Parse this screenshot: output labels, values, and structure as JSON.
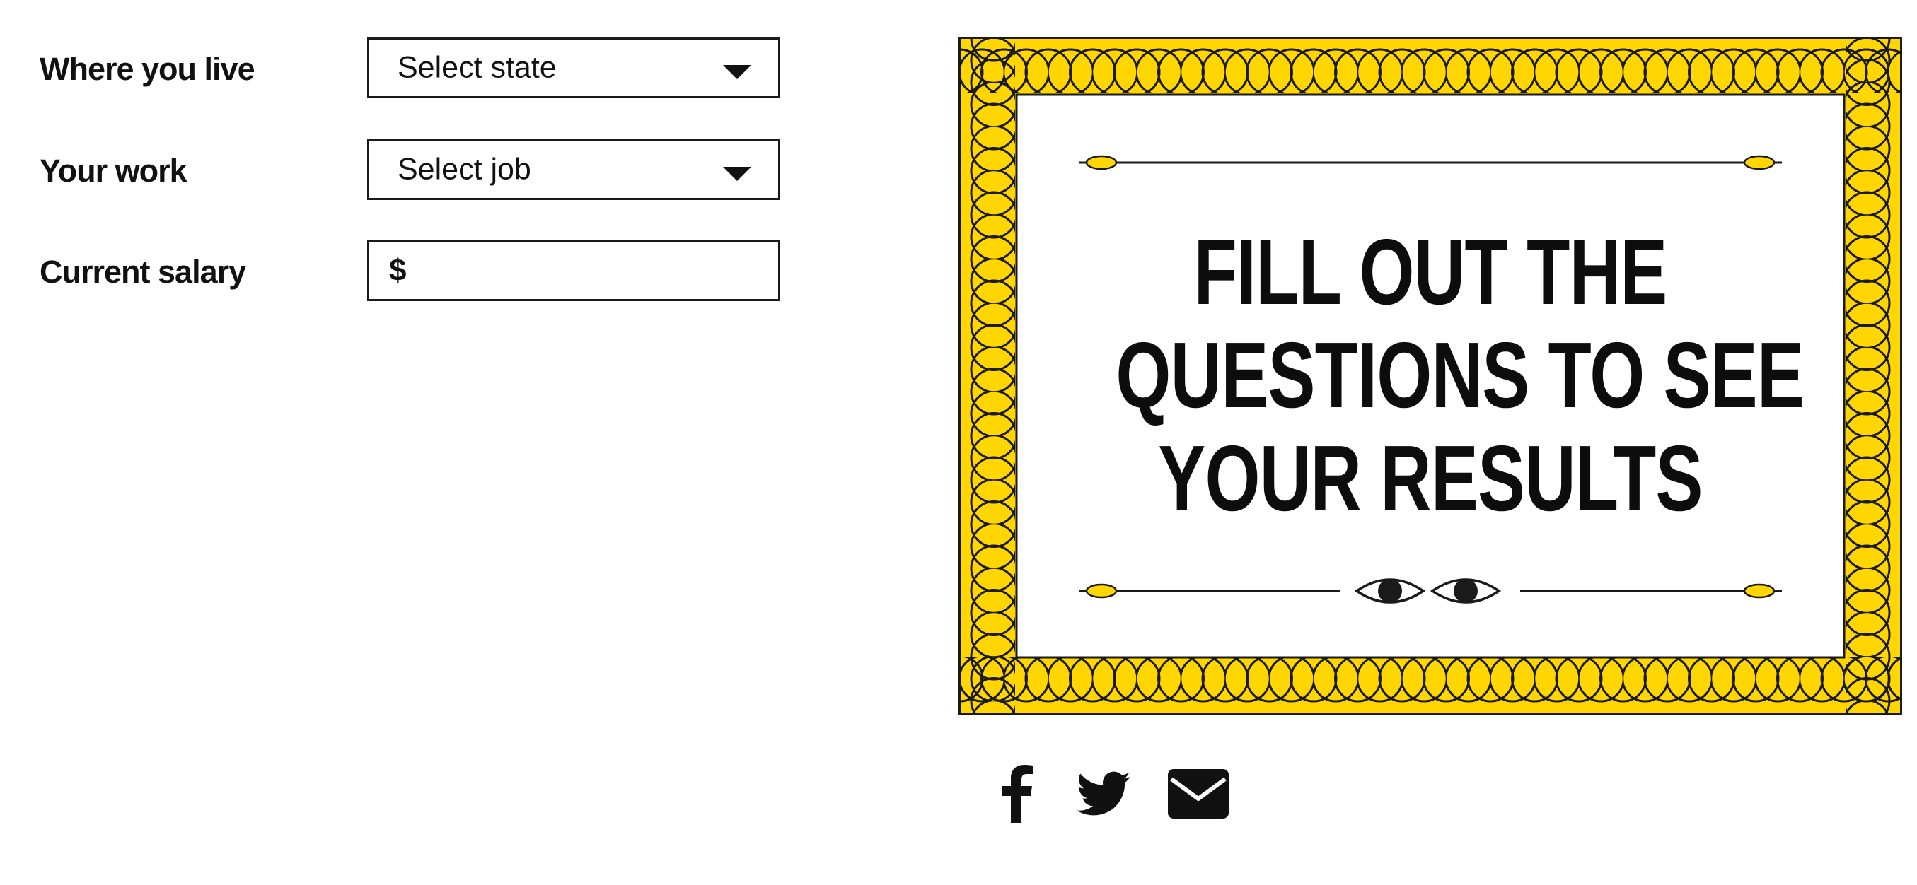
{
  "form": {
    "location": {
      "label": "Where you live",
      "value": "Select state"
    },
    "work": {
      "label": "Your work",
      "value": "Select job"
    },
    "salary": {
      "label": "Current salary",
      "prefix": "$",
      "value": ""
    }
  },
  "results_card": {
    "message_lines": [
      "FILL OUT THE",
      "QUESTIONS TO SEE",
      "YOUR RESULTS"
    ]
  },
  "share": {
    "icons": [
      "facebook-icon",
      "twitter-icon",
      "email-icon"
    ]
  },
  "colors": {
    "accent": "#FFD600",
    "ink": "#111111",
    "background": "#FFFFFF"
  }
}
